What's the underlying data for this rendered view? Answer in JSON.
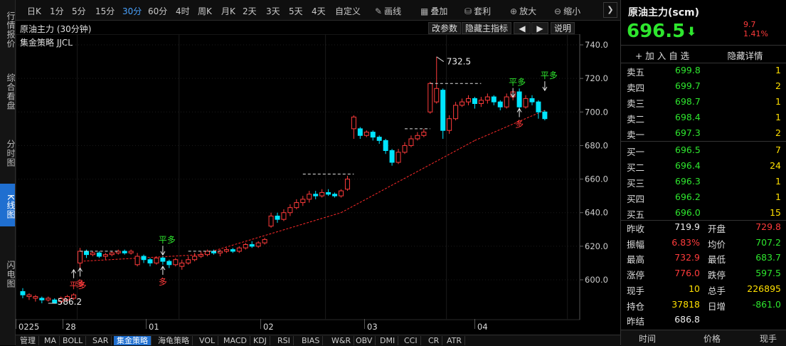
{
  "left_tabs": [
    {
      "label": "行情报价",
      "active": false
    },
    {
      "label": "综合看盘",
      "active": false
    },
    {
      "label": "分时图",
      "active": false
    },
    {
      "label": "K线图",
      "active": true
    },
    {
      "label": "闪电图",
      "active": false
    }
  ],
  "toolbar": {
    "periods": [
      {
        "label": "日K",
        "active": false
      },
      {
        "label": "1分",
        "active": false
      },
      {
        "label": "5分",
        "active": false
      },
      {
        "label": "15分",
        "active": false
      },
      {
        "label": "30分",
        "active": true
      },
      {
        "label": "60分",
        "active": false
      },
      {
        "label": "4时",
        "active": false
      },
      {
        "label": "周K",
        "active": false
      },
      {
        "label": "月K",
        "active": false
      },
      {
        "label": "2天",
        "active": false
      },
      {
        "label": "3天",
        "active": false
      },
      {
        "label": "5天",
        "active": false
      },
      {
        "label": "4天",
        "active": false
      },
      {
        "label": "自定义",
        "active": false
      }
    ],
    "draw_label": "画线",
    "overlay_label": "叠加",
    "template_label": "套利",
    "zoom_in_label": "放大",
    "zoom_out_label": "缩小",
    "next_label": "❯"
  },
  "chart_header": {
    "title": "原油主力 (30分钟)",
    "buttons": [
      "改参数",
      "隐藏主指标",
      "◀",
      "▶",
      "说明"
    ],
    "strategy": "集金策略 JJCL"
  },
  "chart_data": {
    "type": "candlestick",
    "ylim": [
      580,
      745
    ],
    "yticks": [
      740.0,
      720.0,
      700.0,
      680.0,
      660.0,
      640.0,
      620.0,
      600.0
    ],
    "ytick_labels": [
      "740.0",
      "720.0",
      "700.0",
      "680.0",
      "660.0",
      "640.0",
      "620.0",
      "600.0"
    ],
    "x_labels": [
      {
        "label": "0225",
        "idx": 0
      },
      {
        "label": "28",
        "idx": 9
      },
      {
        "label": "01",
        "idx": 25
      },
      {
        "label": "02",
        "idx": 48
      },
      {
        "label": "03",
        "idx": 67
      },
      {
        "label": "04",
        "idx": 86
      }
    ],
    "candles": [
      [
        593,
        591,
        595,
        589
      ],
      [
        590,
        591,
        592,
        588
      ],
      [
        589,
        590,
        591,
        587
      ],
      [
        589,
        588,
        590,
        586
      ],
      [
        588,
        589,
        590,
        587
      ],
      [
        588,
        586,
        589,
        586
      ],
      [
        587,
        589,
        590,
        586
      ],
      [
        588,
        590,
        591,
        587
      ],
      [
        589,
        591,
        592,
        588
      ],
      [
        610,
        617,
        619,
        606
      ],
      [
        617,
        615,
        618,
        613
      ],
      [
        615,
        616,
        617,
        614
      ],
      [
        616,
        614,
        617,
        613
      ],
      [
        614,
        615,
        616,
        612
      ],
      [
        615,
        616,
        617,
        614
      ],
      [
        616,
        617,
        618,
        615
      ],
      [
        617,
        616,
        618,
        615
      ],
      [
        616,
        617,
        618,
        615
      ],
      [
        609,
        614,
        616,
        608
      ],
      [
        614,
        612,
        615,
        610
      ],
      [
        612,
        610,
        613,
        608
      ],
      [
        610,
        613,
        614,
        609
      ],
      [
        613,
        611,
        614,
        609
      ],
      [
        611,
        609,
        612,
        607
      ],
      [
        609,
        612,
        613,
        608
      ],
      [
        608,
        610,
        612,
        606
      ],
      [
        610,
        612,
        614,
        609
      ],
      [
        612,
        614,
        616,
        611
      ],
      [
        614,
        615,
        617,
        613
      ],
      [
        615,
        617,
        618,
        614
      ],
      [
        617,
        616,
        618,
        615
      ],
      [
        616,
        617,
        618,
        614
      ],
      [
        617,
        618,
        619,
        616
      ],
      [
        618,
        617,
        619,
        616
      ],
      [
        617,
        619,
        620,
        616
      ],
      [
        619,
        621,
        622,
        618
      ],
      [
        621,
        620,
        623,
        619
      ],
      [
        620,
        622,
        623,
        619
      ],
      [
        622,
        624,
        625,
        621
      ],
      [
        632,
        638,
        640,
        631
      ],
      [
        638,
        636,
        640,
        634
      ],
      [
        636,
        640,
        642,
        635
      ],
      [
        640,
        643,
        645,
        638
      ],
      [
        643,
        646,
        648,
        642
      ],
      [
        646,
        648,
        650,
        644
      ],
      [
        648,
        651,
        653,
        646
      ],
      [
        651,
        650,
        653,
        648
      ],
      [
        650,
        652,
        654,
        649
      ],
      [
        652,
        651,
        654,
        650
      ],
      [
        651,
        650,
        652,
        649
      ],
      [
        650,
        653,
        654,
        649
      ],
      [
        654,
        660,
        662,
        653
      ],
      [
        690,
        697,
        698,
        684
      ],
      [
        690,
        686,
        691,
        684
      ],
      [
        686,
        688,
        689,
        685
      ],
      [
        688,
        685,
        689,
        683
      ],
      [
        685,
        683,
        686,
        681
      ],
      [
        683,
        677,
        684,
        675
      ],
      [
        677,
        670,
        678,
        668
      ],
      [
        670,
        676,
        678,
        669
      ],
      [
        676,
        680,
        682,
        675
      ],
      [
        680,
        684,
        686,
        679
      ],
      [
        684,
        686,
        688,
        683
      ],
      [
        686,
        688,
        690,
        685
      ],
      [
        700,
        717,
        718,
        699
      ],
      [
        706,
        714,
        732.9,
        705
      ],
      [
        713,
        689,
        714,
        684
      ],
      [
        689,
        696,
        698,
        687
      ],
      [
        696,
        704,
        706,
        695
      ],
      [
        704,
        706,
        708,
        703
      ],
      [
        706,
        708,
        710,
        704
      ],
      [
        708,
        705,
        709,
        702
      ],
      [
        705,
        707,
        709,
        703
      ],
      [
        707,
        709,
        711,
        705
      ],
      [
        709,
        706,
        710,
        704
      ],
      [
        706,
        703,
        707,
        701
      ],
      [
        703,
        709,
        711,
        702
      ],
      [
        709,
        712,
        713,
        707
      ],
      [
        712,
        703,
        714,
        701
      ],
      [
        703,
        708,
        710,
        702
      ],
      [
        708,
        706,
        710,
        704
      ],
      [
        706,
        700,
        707,
        696
      ],
      [
        700,
        696,
        701,
        695
      ]
    ],
    "annotations": {
      "high_label": "732.5",
      "low_label": "586.2",
      "signal_labels": [
        "平多",
        "多",
        "平多",
        "多",
        "平多",
        "多",
        "平多"
      ]
    }
  },
  "date_axis": [
    "0225",
    "28",
    "01",
    "02",
    "03",
    "04"
  ],
  "bottom_tabs": [
    {
      "label": "管理",
      "active": false
    },
    {
      "label": "MA",
      "active": false
    },
    {
      "label": "BOLL",
      "active": false
    },
    {
      "label": "SAR",
      "active": false
    },
    {
      "label": "集金策略",
      "active": true
    },
    {
      "label": "海龟策略",
      "active": false
    },
    {
      "label": "VOL",
      "active": false
    },
    {
      "label": "MACD",
      "active": false
    },
    {
      "label": "KDJ",
      "active": false
    },
    {
      "label": "RSI",
      "active": false
    },
    {
      "label": "BIAS",
      "active": false
    },
    {
      "label": "W&R",
      "active": false
    },
    {
      "label": "OBV",
      "active": false
    },
    {
      "label": "DMI",
      "active": false
    },
    {
      "label": "CCI",
      "active": false
    },
    {
      "label": "CR",
      "active": false
    },
    {
      "label": "ATR",
      "active": false
    }
  ],
  "quote_panel": {
    "name": "原油主力(scm)",
    "price": "696.5",
    "change": "9.7",
    "change_pct": "1.41%",
    "add_watch": "+ 加 入 自 选",
    "hide_detail": "隐藏详情",
    "asks": [
      {
        "label": "卖五",
        "price": "699.8",
        "vol": "1"
      },
      {
        "label": "卖四",
        "price": "699.7",
        "vol": "2"
      },
      {
        "label": "卖三",
        "price": "698.7",
        "vol": "1"
      },
      {
        "label": "卖二",
        "price": "698.4",
        "vol": "1"
      },
      {
        "label": "卖一",
        "price": "697.3",
        "vol": "2"
      }
    ],
    "bids": [
      {
        "label": "买一",
        "price": "696.5",
        "vol": "7"
      },
      {
        "label": "买二",
        "price": "696.4",
        "vol": "24"
      },
      {
        "label": "买三",
        "price": "696.3",
        "vol": "1"
      },
      {
        "label": "买四",
        "price": "696.2",
        "vol": "1"
      },
      {
        "label": "买五",
        "price": "696.0",
        "vol": "15"
      }
    ],
    "stats": [
      {
        "l1": "昨收",
        "v1": "719.9",
        "c1": "#eeeeee",
        "l2": "开盘",
        "v2": "729.8",
        "c2": "#ff3b3b"
      },
      {
        "l1": "振幅",
        "v1": "6.83%",
        "c1": "#ff3b3b",
        "l2": "均价",
        "v2": "707.2",
        "c2": "#2ee62e"
      },
      {
        "l1": "最高",
        "v1": "732.9",
        "c1": "#ff3b3b",
        "l2": "最低",
        "v2": "683.7",
        "c2": "#2ee62e"
      },
      {
        "l1": "涨停",
        "v1": "776.0",
        "c1": "#ff3b3b",
        "l2": "跌停",
        "v2": "597.5",
        "c2": "#2ee62e"
      },
      {
        "l1": "现手",
        "v1": "10",
        "c1": "#ffe000",
        "l2": "总手",
        "v2": "226895",
        "c2": "#ffe000"
      },
      {
        "l1": "持仓",
        "v1": "37818",
        "c1": "#ffe000",
        "l2": "日增",
        "v2": "-861.0",
        "c2": "#2ee62e"
      },
      {
        "l1": "昨结",
        "v1": "686.8",
        "c1": "#eeeeee",
        "l2": "",
        "v2": "",
        "c2": "#eeeeee"
      }
    ],
    "footer": [
      "时间",
      "价格",
      "现手"
    ]
  },
  "colors": {
    "up": "#ff3b3b",
    "down": "#00e5ff",
    "ask_price": "#2ee62e",
    "trend": "#ff2a2a"
  }
}
